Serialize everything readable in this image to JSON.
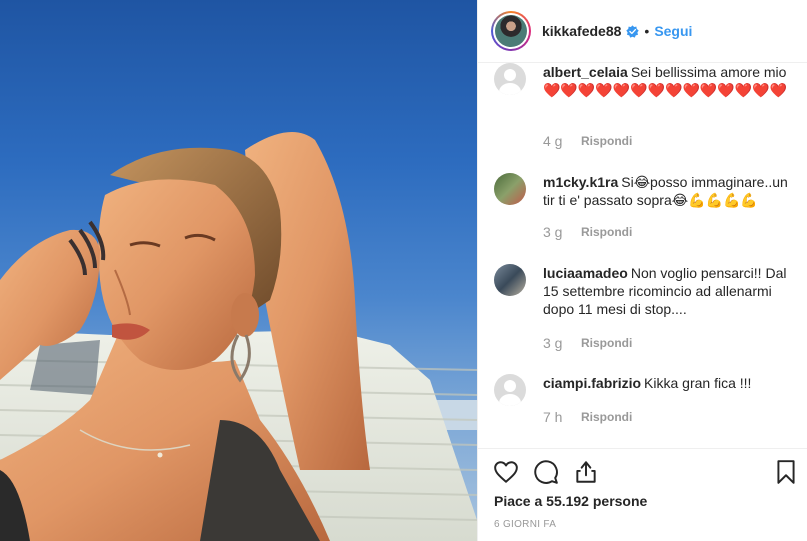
{
  "post": {
    "photo_alt": "Foto di kikkafede88"
  },
  "header": {
    "username": "kikkafede88",
    "separator": "•",
    "follow_label": "Segui"
  },
  "comments": [
    {
      "user": "albert_celaia",
      "text": "Sei bellissima amore mio ❤️❤️❤️❤️❤️❤️❤️❤️❤️❤️❤️❤️❤️❤️",
      "time": "4 g",
      "reply": "Rispondi",
      "avatar": "default"
    },
    {
      "user": "m1cky.k1ra",
      "text": "Si😂posso immaginare..un tir ti e' passato sopra😂💪💪💪💪",
      "time": "3 g",
      "reply": "Rispondi",
      "avatar": "photo"
    },
    {
      "user": "luciaamadeo",
      "text": "Non voglio pensarci!! Dal 15 settembre ricomincio ad allenarmi dopo 11 mesi di stop....",
      "time": "3 g",
      "reply": "Rispondi",
      "avatar": "photo"
    },
    {
      "user": "ciampi.fabrizio",
      "text": "Kikka gran fica !!!",
      "time": "7 h",
      "reply": "Rispondi",
      "avatar": "default"
    }
  ],
  "actions": {
    "icons": [
      "heart-icon",
      "comment-icon",
      "share-icon",
      "bookmark-icon"
    ],
    "likes_text": "Piace a 55.192 persone",
    "date_text": "6 GIORNI FA"
  },
  "colors": {
    "link_blue": "#3897f0",
    "verified_blue": "#3897f0",
    "muted": "#999999",
    "text": "#262626"
  }
}
